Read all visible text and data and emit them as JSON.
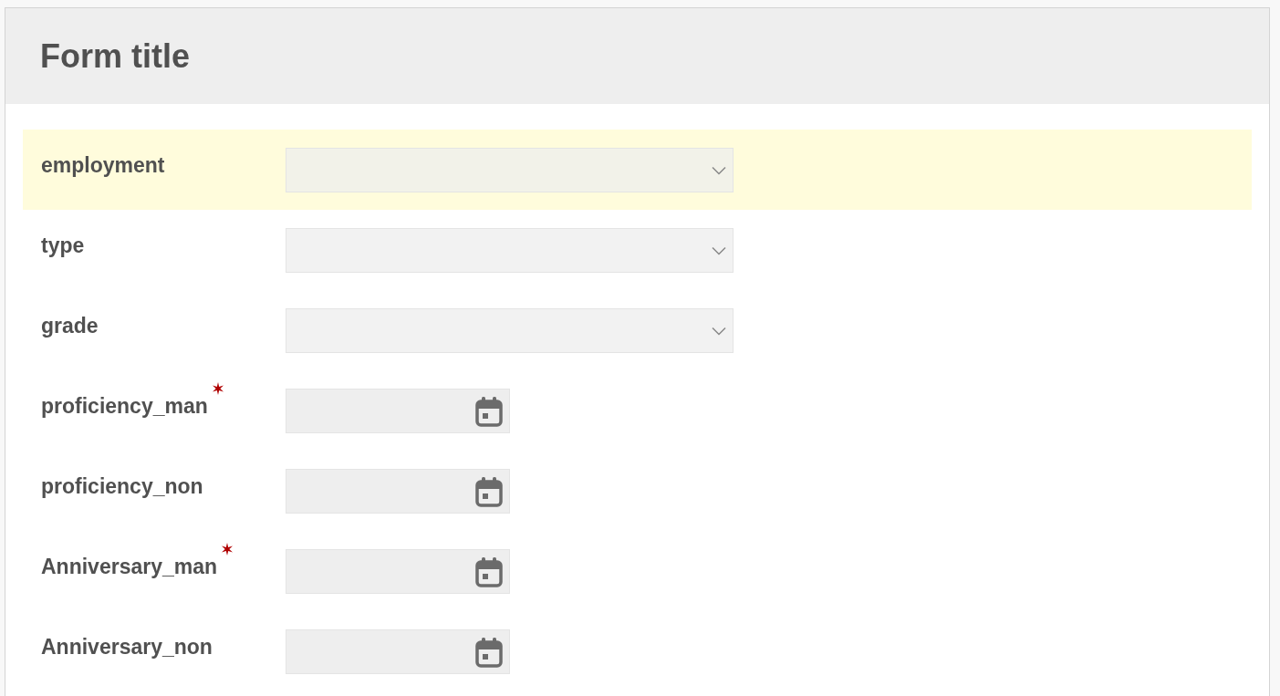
{
  "form": {
    "title": "Form title",
    "fields": [
      {
        "label": "employment",
        "kind": "select",
        "required": false,
        "highlighted": true
      },
      {
        "label": "type",
        "kind": "select",
        "required": false,
        "highlighted": false
      },
      {
        "label": "grade",
        "kind": "select",
        "required": false,
        "highlighted": false
      },
      {
        "label": "proficiency_man",
        "kind": "date",
        "required": true,
        "highlighted": false
      },
      {
        "label": "proficiency_non",
        "kind": "date",
        "required": false,
        "highlighted": false
      },
      {
        "label": "Anniversary_man",
        "kind": "date",
        "required": true,
        "highlighted": false
      },
      {
        "label": "Anniversary_non",
        "kind": "date",
        "required": false,
        "highlighted": false
      }
    ]
  }
}
